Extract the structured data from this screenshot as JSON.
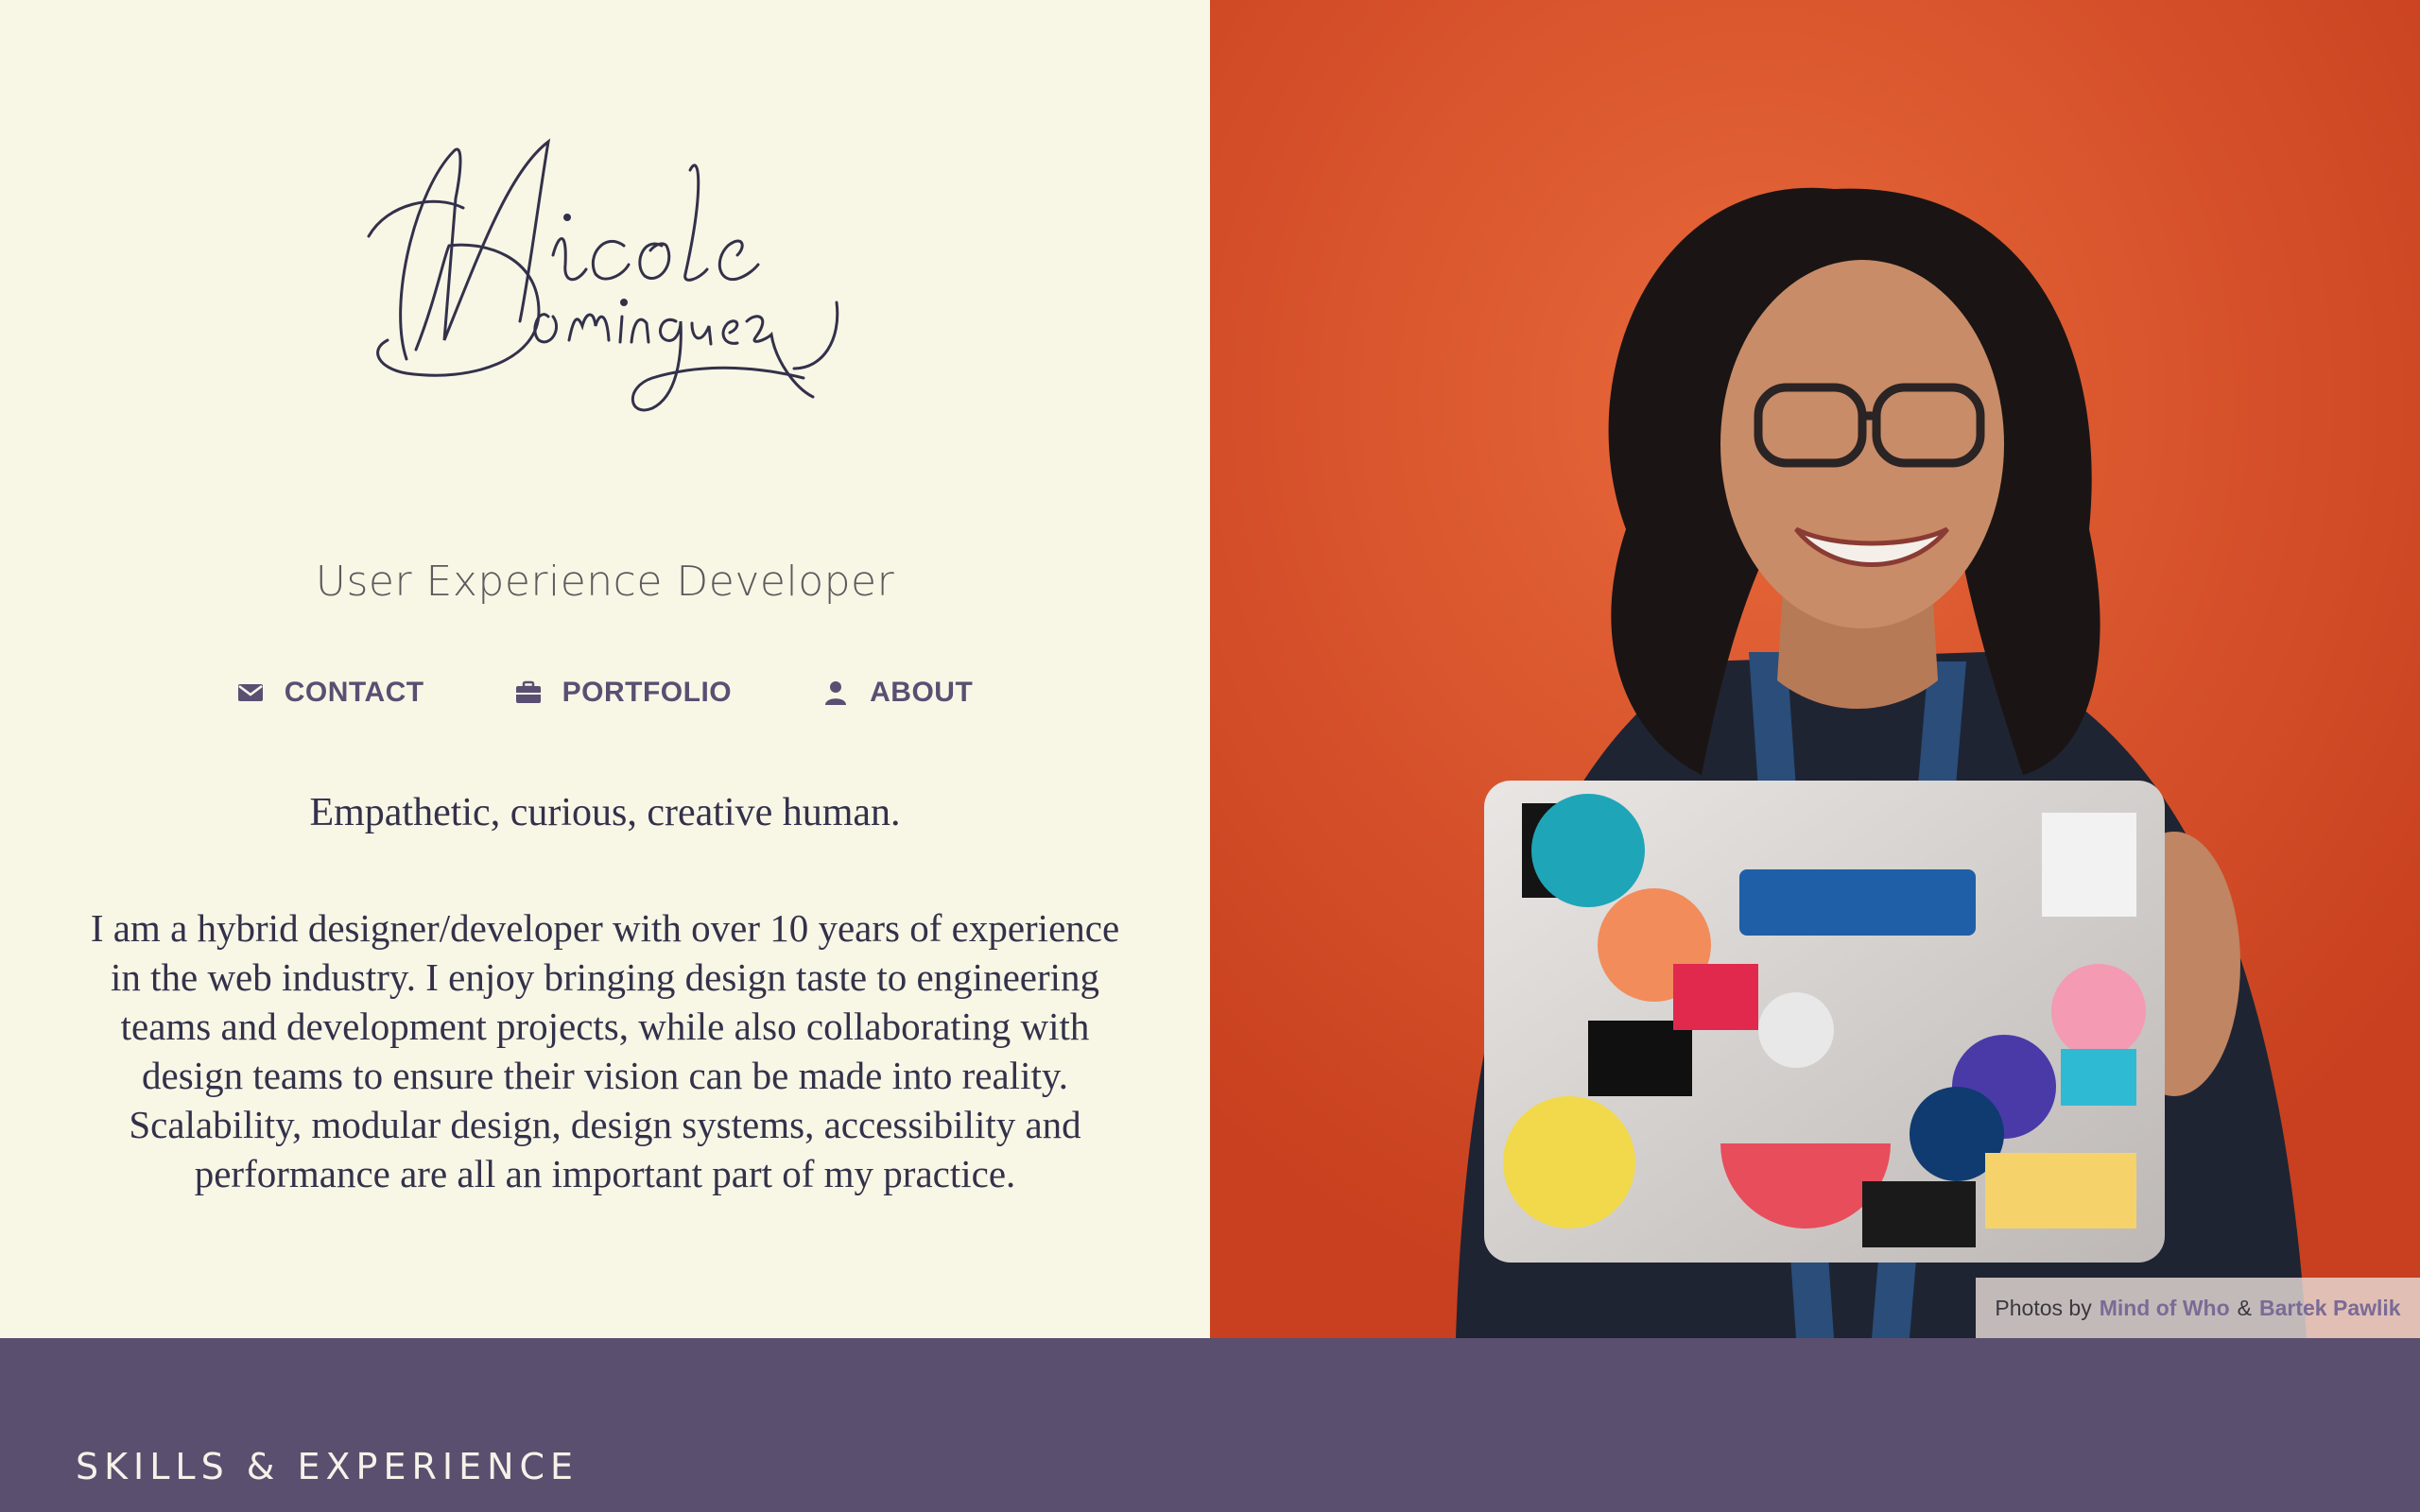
{
  "header": {
    "logo_text": "Nicole Dominguez",
    "role": "User Experience Developer"
  },
  "nav": [
    {
      "label": "CONTACT",
      "icon": "envelope-icon"
    },
    {
      "label": "PORTFOLIO",
      "icon": "briefcase-icon"
    },
    {
      "label": "ABOUT",
      "icon": "user-icon"
    }
  ],
  "intro": {
    "tagline": "Empathetic, curious, creative human.",
    "bio": "I am a hybrid designer/developer with over 10 years of experience in the web industry. I enjoy bringing design taste to engineering teams and development projects, while also collaborating with design teams to ensure their vision can be made into reality. Scalability, modular design, design systems, accessibility and performance are all an important part of my practice."
  },
  "photo_credit": {
    "prefix": "Photos by",
    "photographer_1": "Mind of Who",
    "separator": "&",
    "photographer_2": "Bartek Pawlik"
  },
  "skills": {
    "title": "SKILLS & EXPERIENCE"
  },
  "colors": {
    "background": "#f8f7e6",
    "accent": "#5a4f72",
    "band": "#5a4f6e",
    "photo_bg": "#d9532b"
  }
}
